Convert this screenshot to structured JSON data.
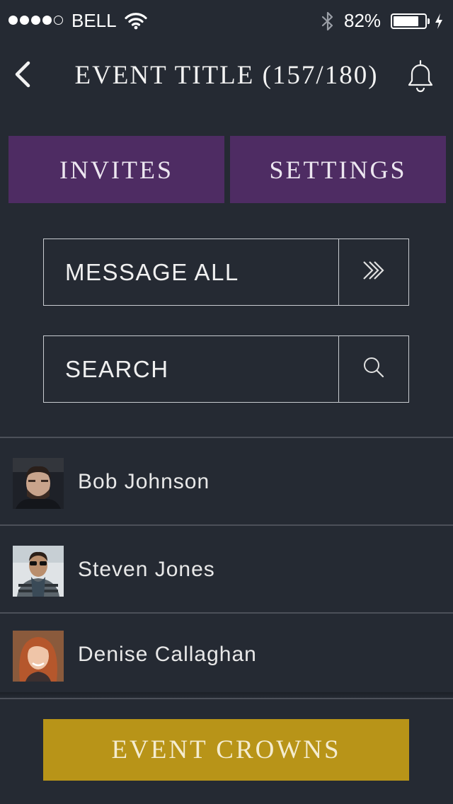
{
  "status_bar": {
    "carrier": "BELL",
    "signal_bars_filled": 4,
    "signal_bars_total": 5,
    "battery_percent_label": "82%",
    "battery_level": 0.82,
    "icons": [
      "wifi-icon",
      "bluetooth-icon",
      "battery-icon",
      "charging-icon"
    ]
  },
  "header": {
    "title": "EVENT TITLE (157/180)",
    "back_icon": "chevron-left-icon",
    "notifications_icon": "bell-icon"
  },
  "tabs": [
    {
      "label": "INVITES"
    },
    {
      "label": "SETTINGS"
    }
  ],
  "message_all": {
    "label": "MESSAGE ALL",
    "icon": "double-chevron-right-icon"
  },
  "search": {
    "placeholder": "SEARCH",
    "value": "",
    "icon": "search-icon"
  },
  "attendees": [
    {
      "name": "Bob Johnson"
    },
    {
      "name": "Steven Jones"
    },
    {
      "name": "Denise Callaghan"
    }
  ],
  "footer": {
    "button_label": "EVENT CROWNS"
  },
  "colors": {
    "background": "#252a33",
    "tab_purple": "#4e2c63",
    "button_gold": "#b89418",
    "border": "#c9ccd1",
    "divider": "#4c5059"
  }
}
